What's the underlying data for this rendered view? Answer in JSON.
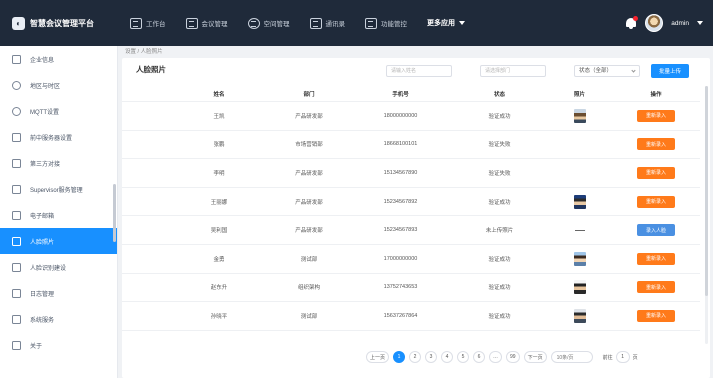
{
  "brand": {
    "title": "智慧会议管理平台"
  },
  "topnav": {
    "items": [
      "工作台",
      "会议管理",
      "空间管理",
      "通讯录",
      "功能管控"
    ],
    "more": "更多应用"
  },
  "user": {
    "name": "admin"
  },
  "sidebar": {
    "items": [
      "企业信息",
      "地区与时区",
      "MQTT设置",
      "前中服务器设置",
      "第三方对接",
      "Supervisor服务管理",
      "电子邮箱",
      "人脸照片",
      "人脸识别建设",
      "日志管理",
      "系统服务",
      "关于"
    ],
    "active_index": 7
  },
  "breadcrumb": "设置 / 人脸照片",
  "page": {
    "title": "人脸照片",
    "filter1_placeholder": "请输入姓名",
    "filter2_placeholder": "请选择部门",
    "status_select": "状态（全部）",
    "batch_button": "批量上传"
  },
  "table": {
    "headers": [
      "姓名",
      "部门",
      "手机号",
      "状态",
      "照片",
      "操作"
    ],
    "rows": [
      {
        "name": "王凯",
        "dept": "产品研发部",
        "phone": "18000000000",
        "status": "验证成功",
        "photo": "a",
        "action": "重新录入",
        "action_style": "orange"
      },
      {
        "name": "张鹏",
        "dept": "市场营销部",
        "phone": "18668100101",
        "status": "验证失败",
        "photo": "",
        "action": "重新录入",
        "action_style": "orange"
      },
      {
        "name": "李明",
        "dept": "产品研发部",
        "phone": "15134567890",
        "status": "验证失败",
        "photo": "",
        "action": "重新录入",
        "action_style": "orange"
      },
      {
        "name": "王丽娜",
        "dept": "产品研发部",
        "phone": "15234567892",
        "status": "验证成功",
        "photo": "b",
        "action": "重新录入",
        "action_style": "orange"
      },
      {
        "name": "吴利国",
        "dept": "产品研发部",
        "phone": "15234567893",
        "status": "未上传照片",
        "photo": "dash",
        "action": "录入人脸",
        "action_style": "blue"
      },
      {
        "name": "金勇",
        "dept": "测试部",
        "phone": "17000000000",
        "status": "验证成功",
        "photo": "c",
        "action": "重新录入",
        "action_style": "orange"
      },
      {
        "name": "赵东升",
        "dept": "组织架构",
        "phone": "13752743653",
        "status": "验证成功",
        "photo": "d",
        "action": "重新录入",
        "action_style": "orange"
      },
      {
        "name": "孙晓平",
        "dept": "测试部",
        "phone": "15637267864",
        "status": "验证成功",
        "photo": "e",
        "action": "重新录入",
        "action_style": "orange"
      }
    ]
  },
  "pagination": {
    "prev": "上一页",
    "pages": [
      "1",
      "2",
      "3",
      "4",
      "5",
      "6",
      "…",
      "99"
    ],
    "active_page": "1",
    "next": "下一页",
    "page_size": "10条/页",
    "jump_label": "前往",
    "jump_value": "1",
    "jump_suffix": "页"
  },
  "colors": {
    "topbar": "#1f2a3a",
    "primary": "#1890ff",
    "orange": "#ff7a1a",
    "blue_button": "#4a90e2"
  }
}
